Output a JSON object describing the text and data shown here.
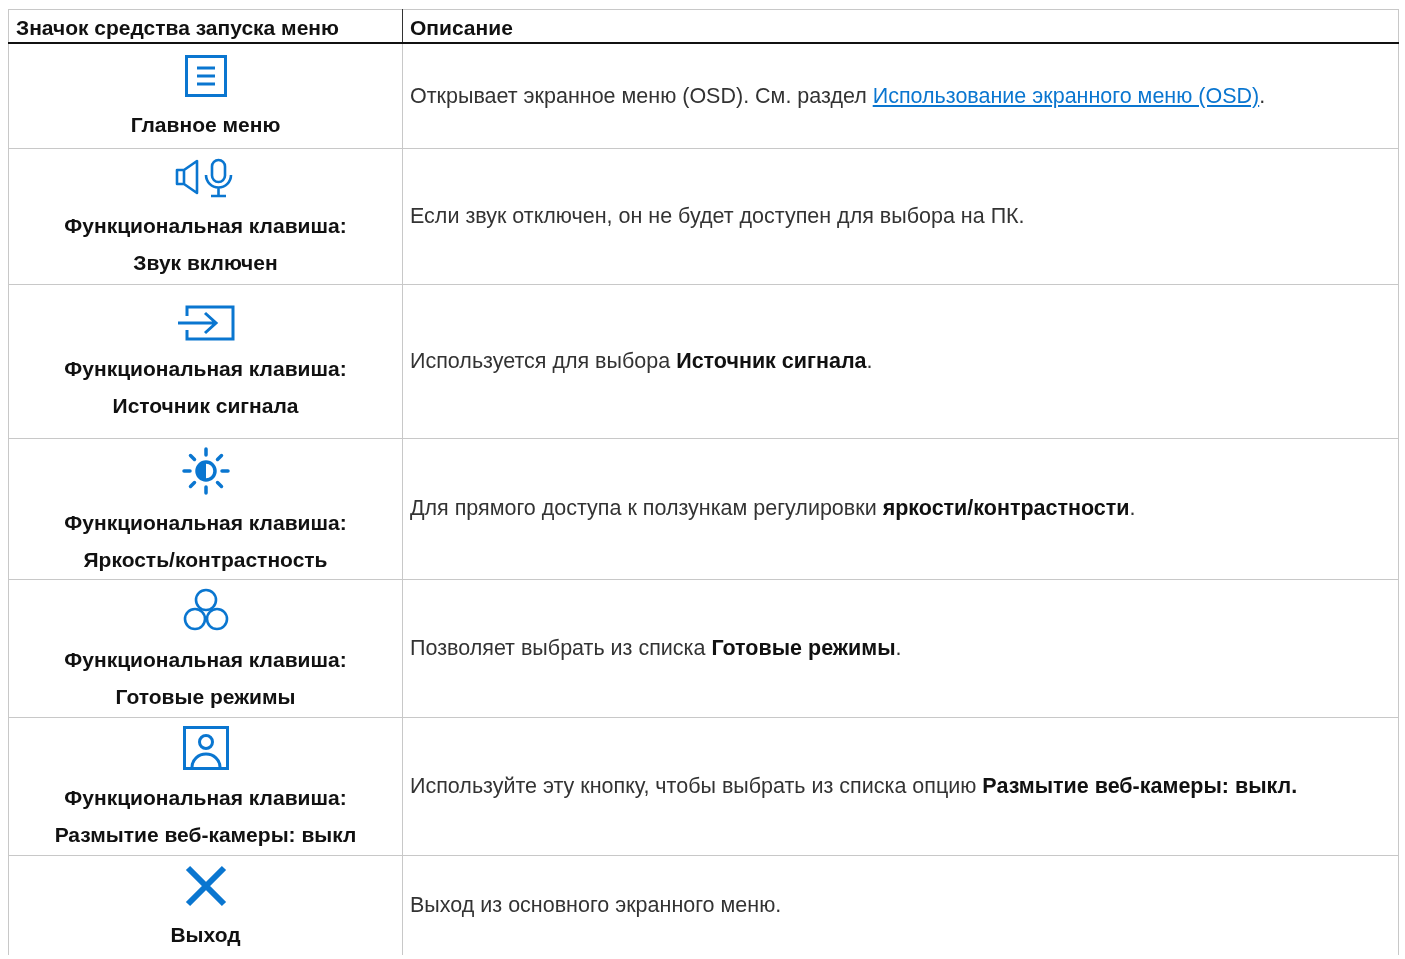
{
  "table": {
    "columns": [
      "Значок средства запуска меню",
      "Описание"
    ],
    "rows": [
      {
        "kind": "menu",
        "label_lines": [
          "Главное меню"
        ],
        "description": [
          {
            "kind": "text",
            "text": "Открывает экранное меню (OSD). См. раздел "
          },
          {
            "kind": "link",
            "text": "Использование экранного меню (OSD)"
          },
          {
            "kind": "text",
            "text": "."
          }
        ]
      },
      {
        "kind": "audio",
        "label_lines": [
          "Функциональная клавиша:",
          "Звук включен"
        ],
        "description": [
          {
            "kind": "text",
            "text": "Если звук отключен, он не будет доступен для выбора на ПК."
          }
        ]
      },
      {
        "kind": "input",
        "label_lines": [
          "Функциональная клавиша:",
          "Источник сигнала"
        ],
        "description": [
          {
            "kind": "text",
            "text": "Используется для выбора **Источник сигнала**."
          }
        ]
      },
      {
        "kind": "brightness",
        "label_lines": [
          "Функциональная клавиша:",
          "Яркость/контрастность"
        ],
        "description": [
          {
            "kind": "text",
            "text": "Для прямого доступа к ползункам регулировки **яркости/контрастности**."
          }
        ]
      },
      {
        "kind": "modes",
        "label_lines": [
          "Функциональная клавиша:",
          "Готовые режимы"
        ],
        "description": [
          {
            "kind": "text",
            "text": "Позволяет выбрать из списка **Готовые режимы**."
          }
        ]
      },
      {
        "kind": "webcam",
        "label_lines": [
          "Функциональная клавиша:",
          "Размытие веб-камеры: выкл"
        ],
        "description": [
          {
            "kind": "text",
            "text": "Используйте эту кнопку, чтобы выбрать из списка опцию **Размытие веб-камеры: выкл.**"
          }
        ]
      },
      {
        "kind": "exit",
        "label_lines": [
          "Выход"
        ],
        "description": [
          {
            "kind": "text",
            "text": "Выход из основного экранного меню."
          }
        ]
      }
    ]
  }
}
